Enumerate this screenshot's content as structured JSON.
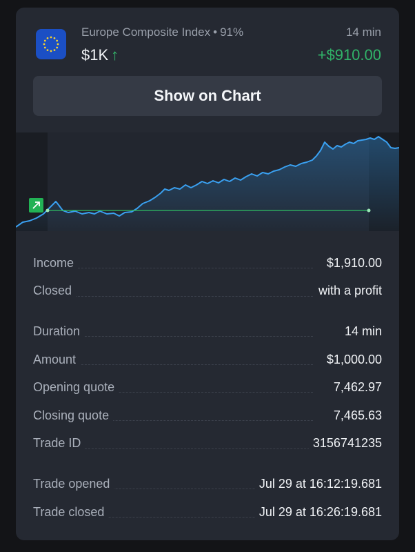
{
  "header": {
    "asset_name": "Europe Composite Index",
    "payout": "91%",
    "duration": "14 min",
    "amount": "$1K",
    "profit": "+$910.00",
    "flag_icon": "eu-flag-icon"
  },
  "actions": {
    "show_on_chart": "Show on Chart"
  },
  "colors": {
    "card": "#252932",
    "profit_green": "#31b469",
    "line_blue": "#3aa0f0",
    "flag_blue": "#1b4fc4"
  },
  "details": {
    "income_label": "Income",
    "income_value": "$1,910.00",
    "closed_label": "Closed",
    "closed_value": "with a profit",
    "duration_label": "Duration",
    "duration_value": "14 min",
    "amount_label": "Amount",
    "amount_value": "$1,000.00",
    "opening_label": "Opening quote",
    "opening_value": "7,462.97",
    "closing_label": "Closing quote",
    "closing_value": "7,465.63",
    "tradeid_label": "Trade ID",
    "tradeid_value": "3156741235",
    "opened_label": "Trade opened",
    "opened_value": "Jul 29 at 16:12:19.681",
    "closedtime_label": "Trade closed",
    "closedtime_value": "Jul 29 at 16:26:19.681"
  }
}
